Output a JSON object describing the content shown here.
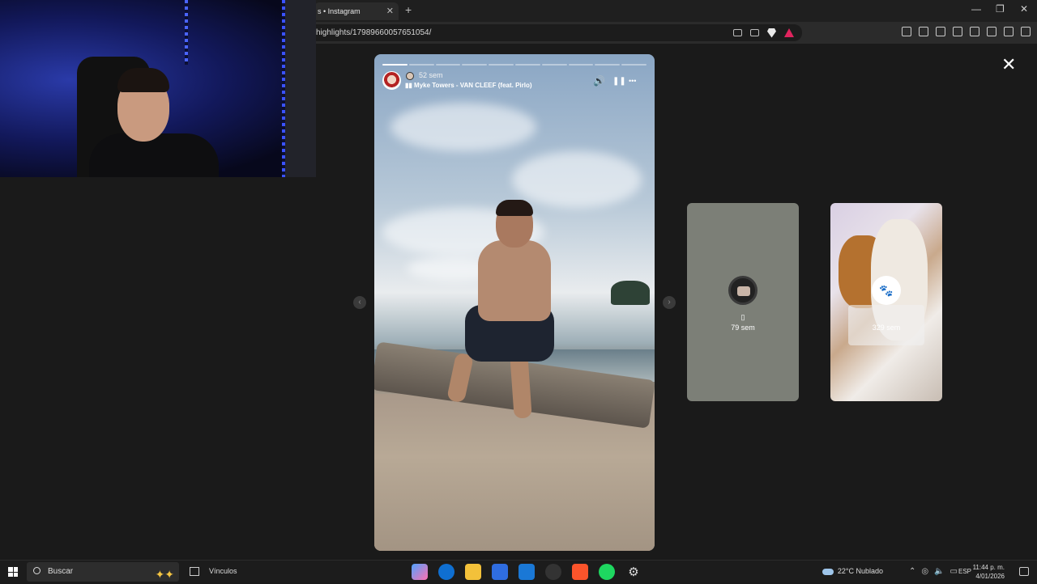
{
  "browser": {
    "tab_title": "s • Instagram",
    "tab_close": "✕",
    "new_tab": "+",
    "url": "highlights/17989660057651054/",
    "window_controls": [
      "—",
      "❐",
      "✕"
    ]
  },
  "story": {
    "time_ago": "52 sem",
    "music": "Myke Towers - VAN CLEEF (feat. Pirlo)",
    "progress_segments": 10,
    "progress_done": 1,
    "volume_icon": "🔊",
    "pause_icon": "❚❚",
    "more_icon": "•••"
  },
  "nav": {
    "prev": "‹",
    "next": "›"
  },
  "cards": [
    {
      "label": "79 sem",
      "glyph": "▯"
    },
    {
      "label": "329 sem",
      "glyph": "🐾"
    }
  ],
  "close": "✕",
  "taskbar": {
    "search_placeholder": "Buscar",
    "sparkle": "✦✦",
    "vinculos": "Vínculos",
    "weather": "22°C  Nublado",
    "lang": "ESP",
    "time": "11:44 p. m.",
    "date": "4/01/2026"
  }
}
